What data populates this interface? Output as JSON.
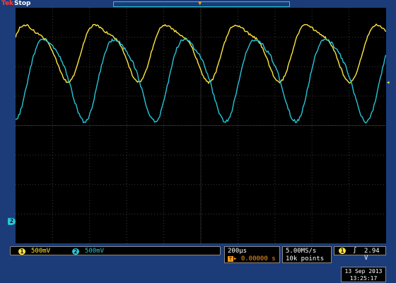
{
  "status": {
    "brand": "Tek",
    "run_state": "Stop"
  },
  "channels": [
    {
      "badge": "1",
      "scale": "500mV",
      "color": "#ffe63b"
    },
    {
      "badge": "2",
      "scale": "500mV",
      "color": "#27c5d8"
    }
  ],
  "ch2_ground_marker": "2",
  "timebase": {
    "scale": "200µs",
    "position": "0.00000 s"
  },
  "acquisition": {
    "sample_rate": "5.00MS/s",
    "record_length": "10k points"
  },
  "trigger": {
    "source_badge": "1",
    "slope_symbol": "ʃ",
    "level": "2.94 V",
    "marker": "◂"
  },
  "datetime": {
    "date": "13 Sep 2013",
    "time": "13:25:17"
  },
  "icons": {
    "trigger_position": "trigger-position-marker-icon",
    "trigger_level": "trigger-level-arrow-icon",
    "slope": "rising-edge-icon"
  },
  "waveforms": {
    "ch1": {
      "color": "#ffe63b",
      "period_divisions": 1.9,
      "amplitude_divisions": 1.8
    },
    "ch2": {
      "color": "#27c5d8",
      "period_divisions": 1.9,
      "amplitude_divisions": 2.7
    }
  }
}
